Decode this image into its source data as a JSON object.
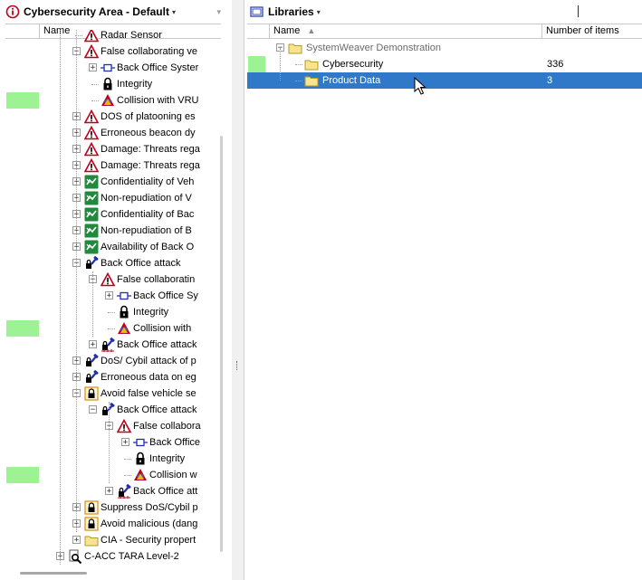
{
  "left_panel": {
    "title": "Cybersecurity Area - Default",
    "columns": {
      "name": "Name"
    },
    "tree": [
      {
        "label": "Radar Sensor",
        "icon": "hazard",
        "depth": 4
      },
      {
        "label": "False collaborating ve",
        "icon": "hazard",
        "depth": 4,
        "exp": "-"
      },
      {
        "label": "Back Office Syster",
        "icon": "component",
        "depth": 5,
        "exp": "+"
      },
      {
        "label": "Integrity",
        "icon": "lock",
        "depth": 5
      },
      {
        "label": "Collision with VRU",
        "icon": "collision",
        "depth": 5
      },
      {
        "label": "DOS of platooning es",
        "icon": "hazard",
        "depth": 4,
        "exp": "+"
      },
      {
        "label": "Erroneous beacon dy",
        "icon": "hazard",
        "depth": 4,
        "exp": "+"
      },
      {
        "label": "Damage: Threats rega",
        "icon": "hazard",
        "depth": 4,
        "exp": "+"
      },
      {
        "label": "Damage: Threats rega",
        "icon": "hazard",
        "depth": 4,
        "exp": "+"
      },
      {
        "label": "Confidentiality of Veh",
        "icon": "green",
        "depth": 4,
        "exp": "+"
      },
      {
        "label": "Non-repudiation of V",
        "icon": "green",
        "depth": 4,
        "exp": "+"
      },
      {
        "label": "Confidentiality of Bac",
        "icon": "green",
        "depth": 4,
        "exp": "+"
      },
      {
        "label": "Non-repudiation of B",
        "icon": "green",
        "depth": 4,
        "exp": "+"
      },
      {
        "label": "Availability of Back O",
        "icon": "green",
        "depth": 4,
        "exp": "+"
      },
      {
        "label": "Back Office attack",
        "icon": "attack",
        "depth": 4,
        "exp": "-"
      },
      {
        "label": "False collaboratin",
        "icon": "hazard",
        "depth": 5,
        "exp": "-"
      },
      {
        "label": "Back Office Sy",
        "icon": "component",
        "depth": 6,
        "exp": "+"
      },
      {
        "label": "Integrity",
        "icon": "lock",
        "depth": 6
      },
      {
        "label": "Collision with",
        "icon": "collision",
        "depth": 6
      },
      {
        "label": "Back Office attack",
        "icon": "attack-tree",
        "depth": 5,
        "exp": "+"
      },
      {
        "label": "DoS/ Cybil attack of p",
        "icon": "attack",
        "depth": 4,
        "exp": "+"
      },
      {
        "label": "Erroneous data on eg",
        "icon": "attack",
        "depth": 4,
        "exp": "+"
      },
      {
        "label": "Avoid false vehicle se",
        "icon": "goal",
        "depth": 4,
        "exp": "-"
      },
      {
        "label": "Back Office attack",
        "icon": "attack",
        "depth": 5,
        "exp": "-"
      },
      {
        "label": "False collabora",
        "icon": "hazard",
        "depth": 6,
        "exp": "-"
      },
      {
        "label": "Back Office",
        "icon": "component",
        "depth": 7,
        "exp": "+"
      },
      {
        "label": "Integrity",
        "icon": "lock",
        "depth": 7
      },
      {
        "label": "Collision w",
        "icon": "collision",
        "depth": 7
      },
      {
        "label": "Back Office att",
        "icon": "attack-tree",
        "depth": 6,
        "exp": "+"
      },
      {
        "label": "Suppress DoS/Cybil p",
        "icon": "goal",
        "depth": 4,
        "exp": "+"
      },
      {
        "label": "Avoid malicious (dang",
        "icon": "goal",
        "depth": 4,
        "exp": "+"
      },
      {
        "label": "CIA - Security propert",
        "icon": "folder",
        "depth": 4,
        "exp": "+"
      },
      {
        "label": "C-ACC TARA Level-2",
        "icon": "search-doc",
        "depth": 3,
        "exp": "+"
      }
    ],
    "green_marks": [
      4,
      18,
      27
    ]
  },
  "right_panel": {
    "title": "Libraries",
    "columns": {
      "name": "Name",
      "count": "Number of items"
    },
    "rows": [
      {
        "label": "SystemWeaver Demonstration",
        "count": "",
        "depth": 0,
        "exp": "-",
        "grey": true
      },
      {
        "label": "Cybersecurity",
        "count": "336",
        "depth": 1
      },
      {
        "label": "Product Data",
        "count": "3",
        "depth": 1,
        "selected": true
      }
    ]
  },
  "colors": {
    "selection": "#3079c8",
    "green_mark": "#9df294",
    "alert": "#c0001a",
    "tree_green": "#1f8a3b"
  }
}
